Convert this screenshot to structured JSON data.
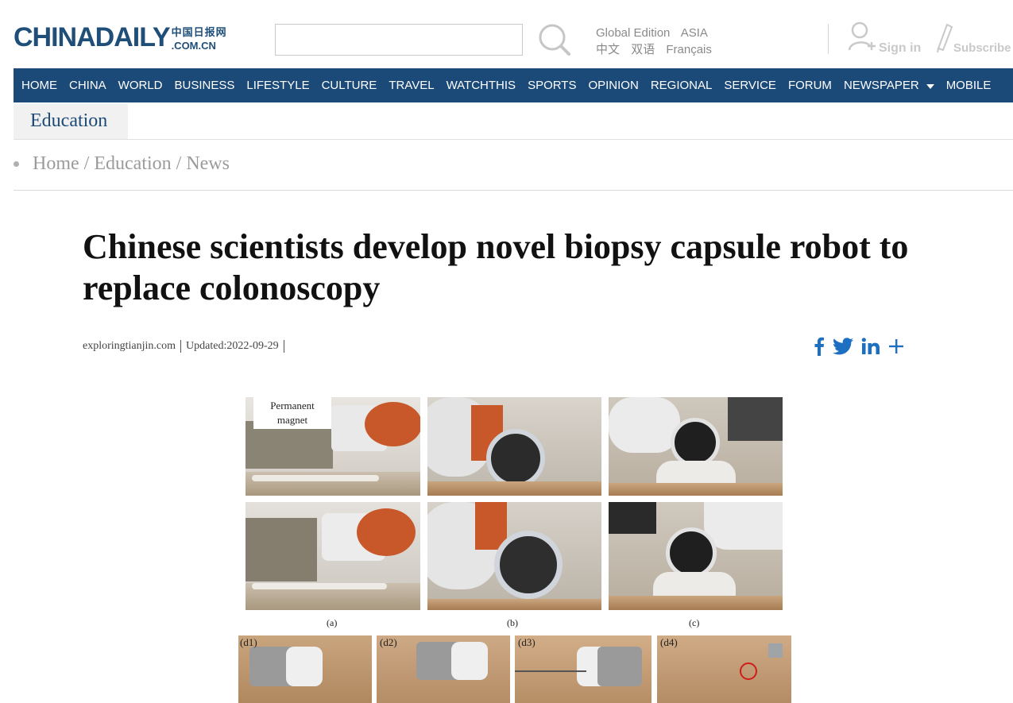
{
  "brand": {
    "logo_main_a": "CHINA",
    "logo_main_b": "DAILY",
    "logo_cn": "中国日报网",
    "logo_domain": ".COM.CN"
  },
  "header": {
    "editions_row1": [
      "Global Edition",
      "ASIA"
    ],
    "editions_row2": [
      "中文",
      "双语",
      "Français"
    ],
    "signin": "Sign in",
    "subscribe": "Subscribe"
  },
  "nav": {
    "items": [
      "HOME",
      "CHINA",
      "WORLD",
      "BUSINESS",
      "LIFESTYLE",
      "CULTURE",
      "TRAVEL",
      "WATCHTHIS",
      "SPORTS",
      "OPINION",
      "REGIONAL",
      "SERVICE",
      "FORUM",
      "NEWSPAPER",
      "MOBILE"
    ]
  },
  "section": {
    "tab": "Education"
  },
  "breadcrumb": {
    "items": [
      "Home",
      "Education",
      "News"
    ],
    "separator": "/"
  },
  "article": {
    "headline": "Chinese scientists develop novel biopsy capsule robot to replace colonoscopy",
    "source": "exploringtianjin.com",
    "updated": "Updated:2022-09-29"
  },
  "share": {
    "icons": [
      "facebook-icon",
      "twitter-icon",
      "linkedin-icon",
      "plus-icon"
    ],
    "color": "#1c6fc1"
  },
  "figure": {
    "magnet_label_1": "Permanent",
    "magnet_label_2": "magnet",
    "captions": [
      "(a)",
      "(b)",
      "(c)"
    ],
    "sub_labels": [
      "(d1)",
      "(d2)",
      "(d3)",
      "(d4)"
    ]
  },
  "colors": {
    "nav_bg": "#1c4a78",
    "brand": "#1f4e79"
  }
}
